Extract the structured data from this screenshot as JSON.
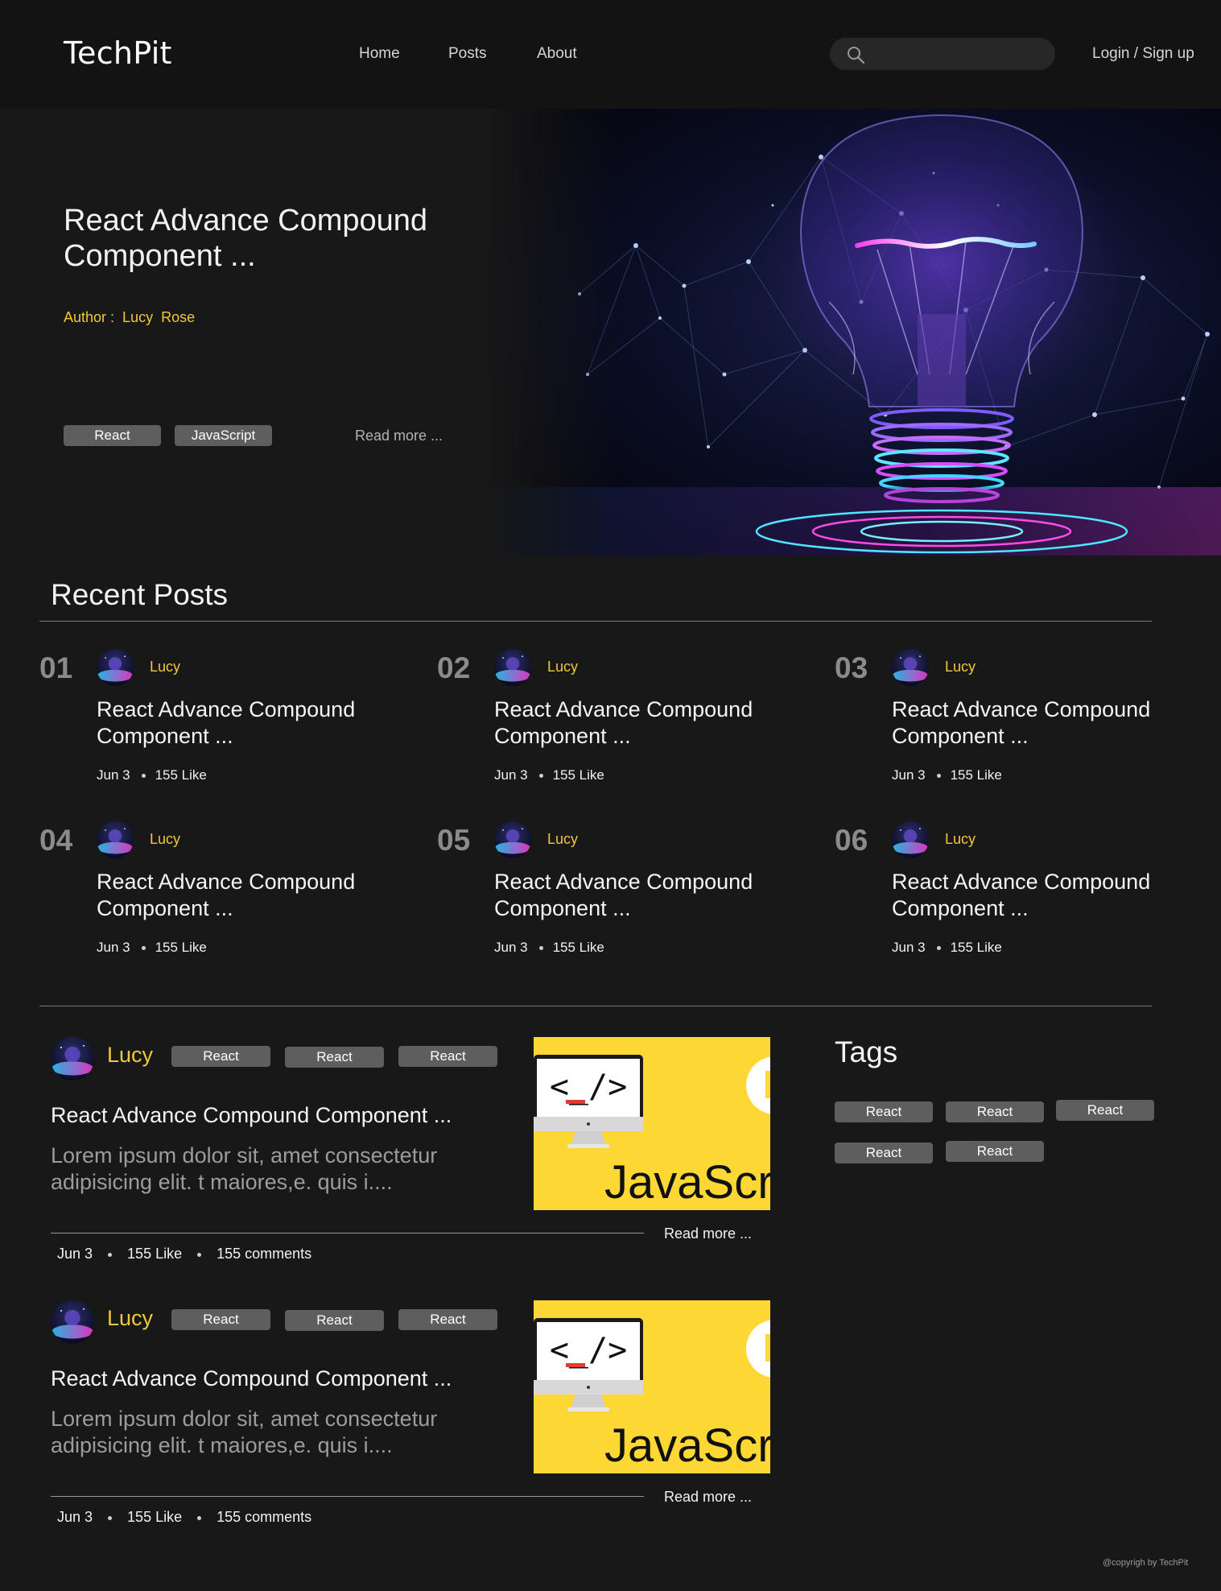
{
  "header": {
    "logo": "TechPit",
    "nav": [
      "Home",
      "Posts",
      "About"
    ],
    "search_placeholder": "",
    "login": "Login / Sign up"
  },
  "hero": {
    "title": "React Advance Compound Component ...",
    "author_label": "Author :",
    "author_first": "Lucy",
    "author_last": "Rose",
    "tags": [
      "React",
      "JavaScript"
    ],
    "read_more": "Read more ..."
  },
  "recent": {
    "heading": "Recent Posts",
    "posts": [
      {
        "num": "01",
        "author": "Lucy",
        "title": "React Advance Compound Component ...",
        "date": "Jun 3",
        "likes": "155 Like"
      },
      {
        "num": "02",
        "author": "Lucy",
        "title": "React Advance Compound Component ...",
        "date": "Jun 3",
        "likes": "155 Like"
      },
      {
        "num": "03",
        "author": "Lucy",
        "title": "React Advance Compound Component ...",
        "date": "Jun 3",
        "likes": "155 Like"
      },
      {
        "num": "04",
        "author": "Lucy",
        "title": "React Advance Compound Component ...",
        "date": "Jun 3",
        "likes": "155 Like"
      },
      {
        "num": "05",
        "author": "Lucy",
        "title": "React Advance Compound Component ...",
        "date": "Jun 3",
        "likes": "155 Like"
      },
      {
        "num": "06",
        "author": "Lucy",
        "title": "React Advance Compound Component ...",
        "date": "Jun 3",
        "likes": "155 Like"
      }
    ]
  },
  "articles": [
    {
      "author": "Lucy",
      "tags": [
        "React",
        "React",
        "React"
      ],
      "title": "React Advance Compound Component ...",
      "excerpt": "Lorem ipsum dolor sit, amet consectetur adipisicing elit. t maiores,e. quis i....",
      "thumb_text": "JavaScri",
      "read_more": "Read more ...",
      "date": "Jun 3",
      "likes": "155 Like",
      "comments": "155 comments"
    },
    {
      "author": "Lucy",
      "tags": [
        "React",
        "React",
        "React"
      ],
      "title": "React Advance Compound Component ...",
      "excerpt": "Lorem ipsum dolor sit, amet consectetur adipisicing elit. t maiores,e. quis i....",
      "thumb_text": "JavaScri",
      "read_more": "Read more ...",
      "date": "Jun 3",
      "likes": "155 Like",
      "comments": "155 comments"
    }
  ],
  "tags": {
    "heading": "Tags",
    "items": [
      "React",
      "React",
      "React",
      "React",
      "React"
    ]
  },
  "footer": "@copyrigh by TechPit",
  "colors": {
    "background": "#181818",
    "header": "#131313",
    "accent": "#f0c838",
    "pill": "#5e5e5e",
    "thumb_yellow": "#fdd835"
  },
  "icons": {
    "search": "search-icon"
  }
}
